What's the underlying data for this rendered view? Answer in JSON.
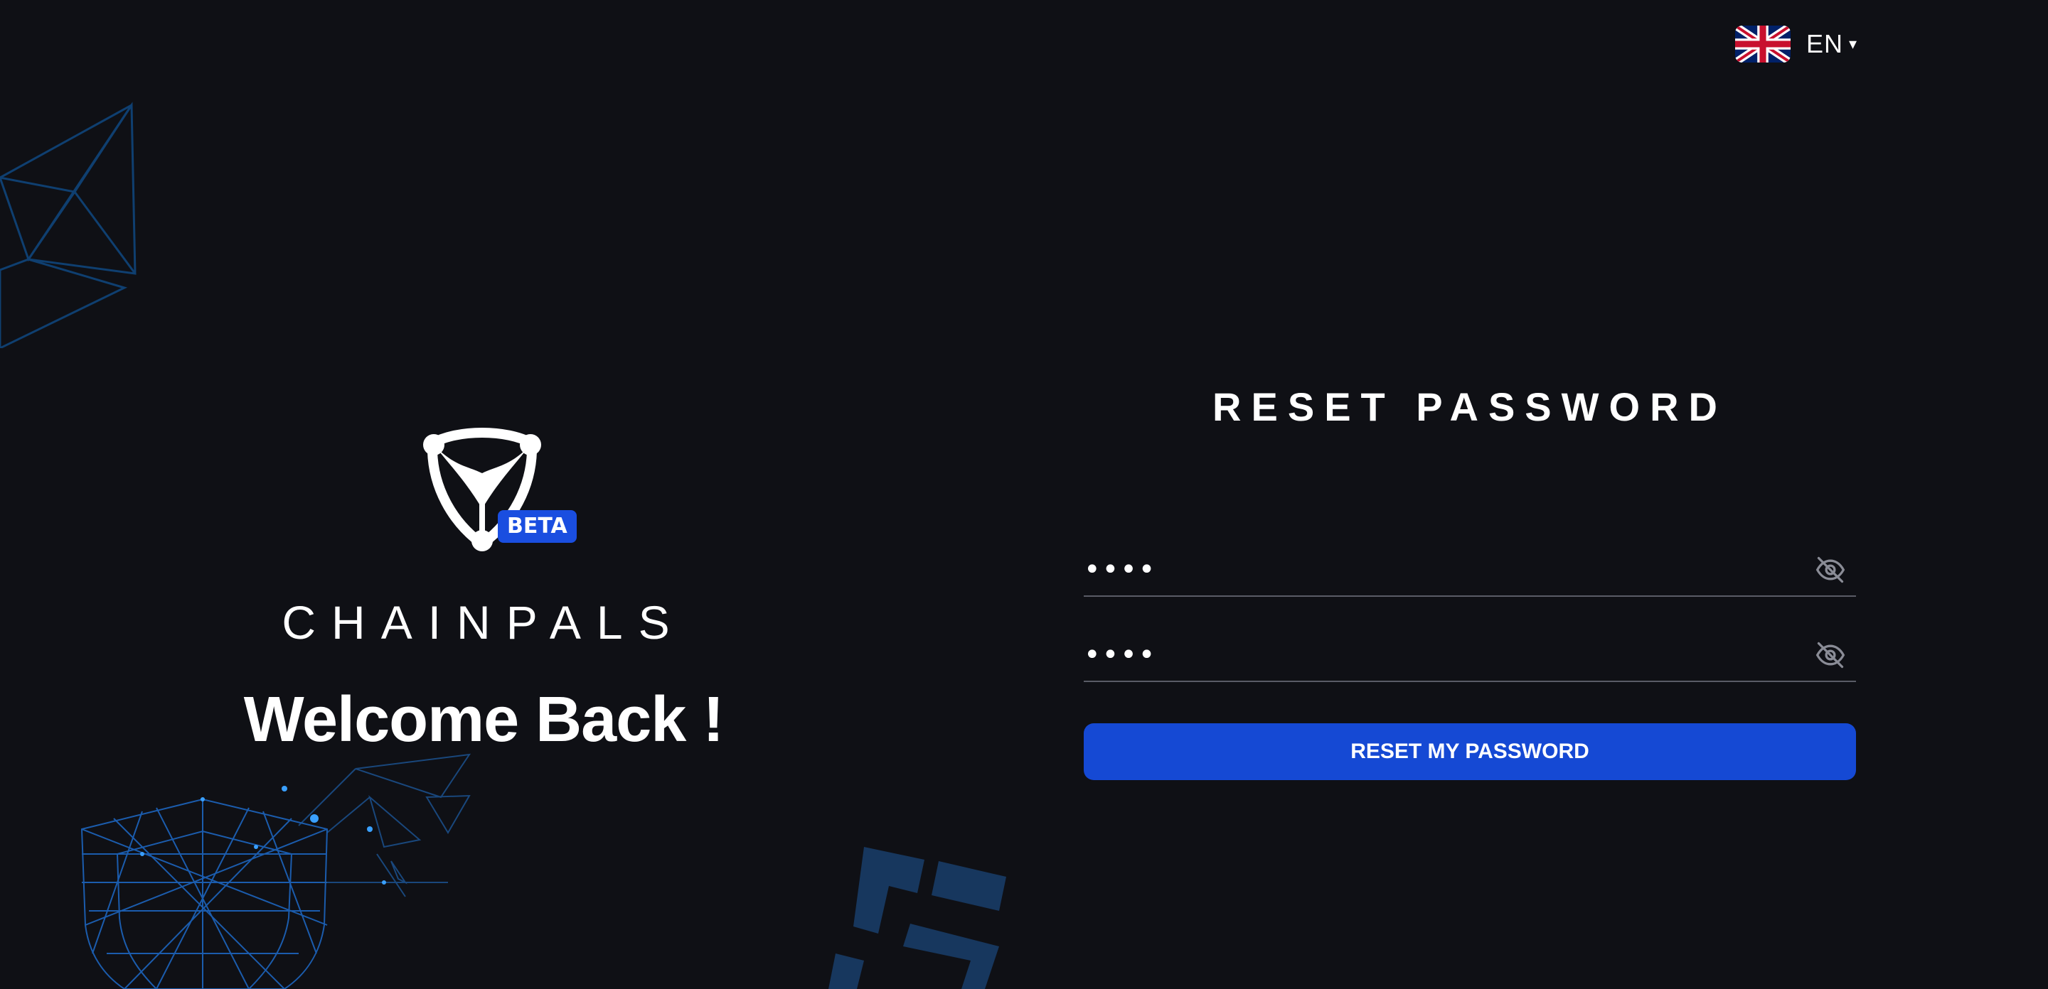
{
  "language": {
    "code": "EN",
    "caret": "▾",
    "flag_icon": "uk-flag-icon"
  },
  "brand": {
    "badge": "BETA",
    "name": "CHAINPALS",
    "welcome": "Welcome Back !"
  },
  "form": {
    "title": "RESET PASSWORD",
    "new_password_value": "••••",
    "confirm_password_value": "••••",
    "visibility_icon": "eye-off-icon",
    "submit_label": "RESET MY PASSWORD"
  },
  "colors": {
    "background": "#0f1015",
    "accent": "#1549d4",
    "badge": "#1a4ee0",
    "decoration": "#1a5fb0"
  }
}
